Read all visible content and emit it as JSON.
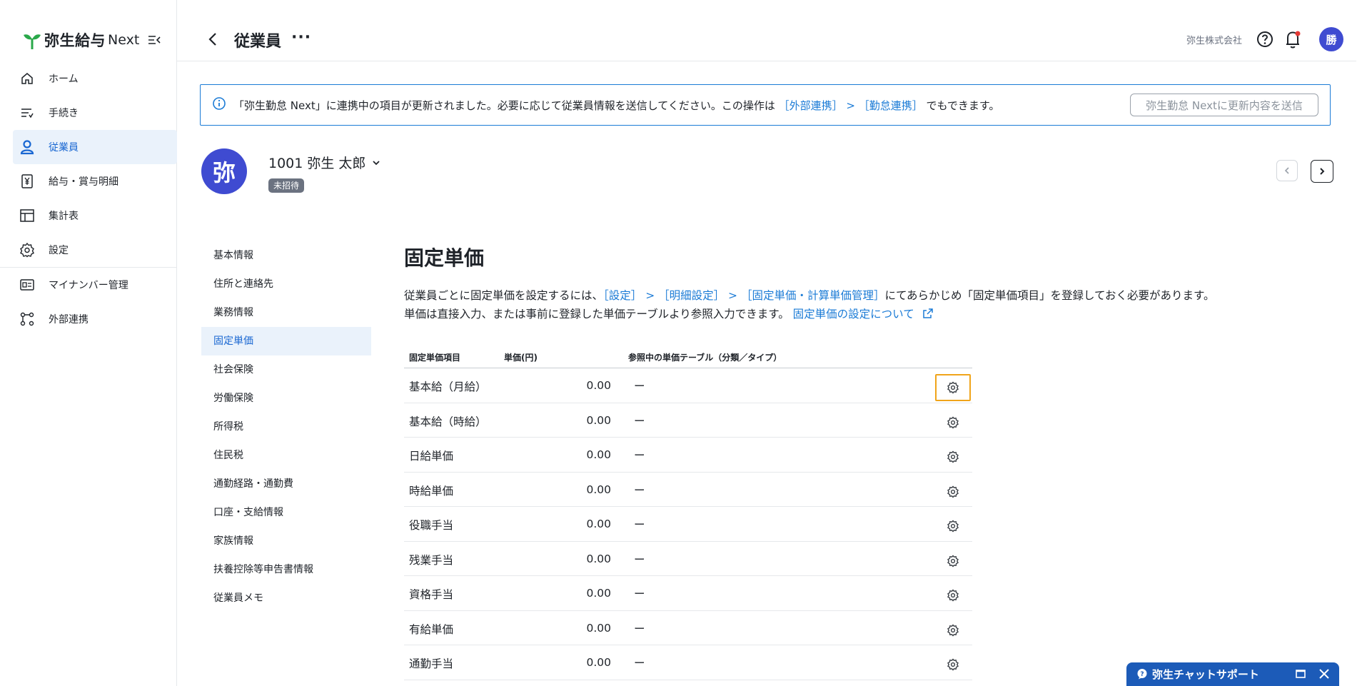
{
  "app": {
    "logo_text": "弥生給与",
    "logo_suffix": "Next"
  },
  "sidebar": {
    "items": [
      {
        "label": "ホーム",
        "icon": "home-icon"
      },
      {
        "label": "手続き",
        "icon": "procedure-list-icon"
      },
      {
        "label": "従業員",
        "icon": "person-icon",
        "active": true
      },
      {
        "label": "給与・賞与明細",
        "icon": "yen-document-icon"
      },
      {
        "label": "集計表",
        "icon": "table-icon"
      },
      {
        "label": "設定",
        "icon": "gear-icon"
      },
      {
        "label": "マイナンバー管理",
        "icon": "id-card-icon"
      },
      {
        "label": "外部連携",
        "icon": "integration-icon"
      }
    ]
  },
  "header": {
    "title": "従業員",
    "more": "···",
    "company": "弥生株式会社",
    "user_initial": "勝"
  },
  "banner": {
    "text_before": "「弥生勤怠 Next」に連携中の項目が更新されました。必要に応じて従業員情報を送信してください。この操作は",
    "link1": "［外部連携］",
    "separator": " > ",
    "link2": "［勤怠連携］",
    "text_after": "でもできます。",
    "button": "弥生勤怠 Nextに更新内容を送信"
  },
  "employee": {
    "avatar_char": "弥",
    "name": "1001 弥生 太郎",
    "badge": "未招待"
  },
  "subnav": {
    "items": [
      {
        "label": "基本情報"
      },
      {
        "label": "住所と連絡先"
      },
      {
        "label": "業務情報"
      },
      {
        "label": "固定単価",
        "active": true
      },
      {
        "label": "社会保険"
      },
      {
        "label": "労働保険"
      },
      {
        "label": "所得税"
      },
      {
        "label": "住民税"
      },
      {
        "label": "通勤経路・通勤費"
      },
      {
        "label": "口座・支給情報"
      },
      {
        "label": "家族情報"
      },
      {
        "label": "扶養控除等申告書情報"
      },
      {
        "label": "従業員メモ"
      }
    ]
  },
  "main": {
    "title": "固定単価",
    "desc1_before": "従業員ごとに固定単価を設定するには、",
    "desc1_link": "［設定］ > ［明細設定］ > ［固定単価・計算単価管理］",
    "desc1_after": "にてあらかじめ「固定単価項目」を登録しておく必要があります。",
    "desc2_before": "単価は直接入力、または事前に登録した単価テーブルより参照入力できます。",
    "desc2_link": "固定単価の設定について",
    "table": {
      "headers": {
        "item": "固定単価項目",
        "price": "単価(円)",
        "ref": "参照中の単価テーブル（分類／タイプ）"
      },
      "rows": [
        {
          "name": "基本給（月給）",
          "value": "0.00",
          "ref": "ー"
        },
        {
          "name": "基本給（時給）",
          "value": "0.00",
          "ref": "ー"
        },
        {
          "name": "日給単価",
          "value": "0.00",
          "ref": "ー"
        },
        {
          "name": "時給単価",
          "value": "0.00",
          "ref": "ー"
        },
        {
          "name": "役職手当",
          "value": "0.00",
          "ref": "ー"
        },
        {
          "name": "残業手当",
          "value": "0.00",
          "ref": "ー"
        },
        {
          "name": "資格手当",
          "value": "0.00",
          "ref": "ー"
        },
        {
          "name": "有給単価",
          "value": "0.00",
          "ref": "ー"
        },
        {
          "name": "通勤手当",
          "value": "0.00",
          "ref": "ー"
        }
      ]
    }
  },
  "chat": {
    "label": "弥生チャットサポート"
  },
  "colors": {
    "accent": "#1b7bd6",
    "avatar": "#3f4bd1",
    "active_bg": "#eaf2fb",
    "highlight": "#f0a41a",
    "chat_bg": "#1c5bb8"
  }
}
